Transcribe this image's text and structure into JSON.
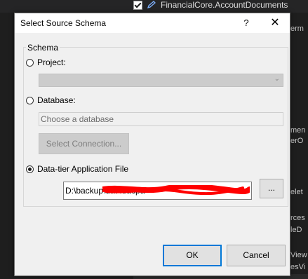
{
  "background": {
    "row_text": "FinancialCore.AccountDocuments",
    "fragments": [
      "erm",
      "men",
      "erO",
      "elet",
      "rces",
      "leD",
      "View",
      "esVi"
    ]
  },
  "dialog": {
    "title": "Select Source Schema",
    "help": "?",
    "close": "✕",
    "group_label": "Schema",
    "project_label": "Project:",
    "database_label": "Database:",
    "database_placeholder": "Choose a database",
    "select_connection_label": "Select Connection...",
    "dacpac_label": "Data-tier Application File",
    "file_value": "D:\\backup\\dat                                              .dacpa",
    "browse_label": "...",
    "ok_label": "OK",
    "cancel_label": "Cancel",
    "selected_option": "Data-tier Application File"
  },
  "colors": {
    "accent": "#0078d7",
    "redaction": "#ff0000",
    "ide_background": "#1e1e1e"
  }
}
